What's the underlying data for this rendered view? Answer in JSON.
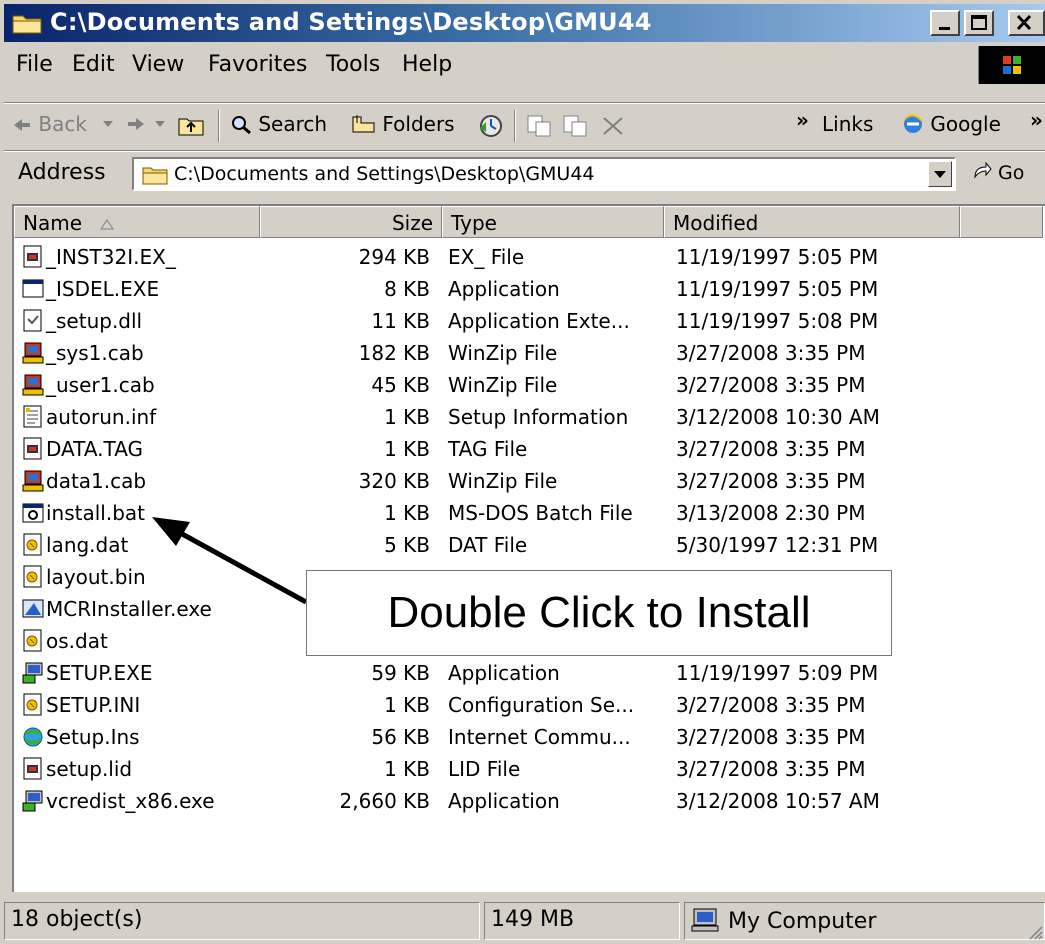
{
  "window": {
    "title": "C:\\Documents and Settings\\Desktop\\GMU44"
  },
  "menu": [
    {
      "label": "File"
    },
    {
      "label": "Edit"
    },
    {
      "label": "View"
    },
    {
      "label": "Favorites"
    },
    {
      "label": "Tools"
    },
    {
      "label": "Help"
    }
  ],
  "toolbar": {
    "back_label": "Back",
    "search_label": "Search",
    "folders_label": "Folders",
    "more_label": "»",
    "links_label": "Links",
    "google_label": "Google",
    "more2_label": "»"
  },
  "address": {
    "label": "Address",
    "value": "C:\\Documents and Settings\\Desktop\\GMU44",
    "go_label": "Go"
  },
  "columns": {
    "name": "Name",
    "size": "Size",
    "type": "Type",
    "modified": "Modified"
  },
  "files": [
    {
      "name": "_INST32I.EX_",
      "size": "294 KB",
      "type": "EX_ File",
      "modified": "11/19/1997 5:05 PM",
      "icon": "generic-file-icon"
    },
    {
      "name": "_ISDEL.EXE",
      "size": "8 KB",
      "type": "Application",
      "modified": "11/19/1997 5:05 PM",
      "icon": "exe-window-icon"
    },
    {
      "name": "_setup.dll",
      "size": "11 KB",
      "type": "Application Exte...",
      "modified": "11/19/1997 5:08 PM",
      "icon": "dll-icon"
    },
    {
      "name": "_sys1.cab",
      "size": "182 KB",
      "type": "WinZip File",
      "modified": "3/27/2008 3:35 PM",
      "icon": "winzip-icon"
    },
    {
      "name": "_user1.cab",
      "size": "45 KB",
      "type": "WinZip File",
      "modified": "3/27/2008 3:35 PM",
      "icon": "winzip-icon"
    },
    {
      "name": "autorun.inf",
      "size": "1 KB",
      "type": "Setup Information",
      "modified": "3/12/2008 10:30 AM",
      "icon": "inf-icon"
    },
    {
      "name": "DATA.TAG",
      "size": "1 KB",
      "type": "TAG File",
      "modified": "3/27/2008 3:35 PM",
      "icon": "generic-file-icon"
    },
    {
      "name": "data1.cab",
      "size": "320 KB",
      "type": "WinZip File",
      "modified": "3/27/2008 3:35 PM",
      "icon": "winzip-icon"
    },
    {
      "name": "install.bat",
      "size": "1 KB",
      "type": "MS-DOS Batch File",
      "modified": "3/13/2008 2:30 PM",
      "icon": "batch-file-icon"
    },
    {
      "name": "lang.dat",
      "size": "5 KB",
      "type": "DAT File",
      "modified": "5/30/1997 12:31 PM",
      "icon": "dat-file-icon"
    },
    {
      "name": "layout.bin",
      "size": "",
      "type": "",
      "modified": "",
      "icon": "dat-file-icon"
    },
    {
      "name": "MCRInstaller.exe",
      "size": "",
      "type": "",
      "modified": "",
      "icon": "installer-icon"
    },
    {
      "name": "os.dat",
      "size": "",
      "type": "",
      "modified": "",
      "icon": "dat-file-icon"
    },
    {
      "name": "SETUP.EXE",
      "size": "59 KB",
      "type": "Application",
      "modified": "11/19/1997 5:09 PM",
      "icon": "setup-exe-icon"
    },
    {
      "name": "SETUP.INI",
      "size": "1 KB",
      "type": "Configuration Se...",
      "modified": "3/27/2008 3:35 PM",
      "icon": "dat-file-icon"
    },
    {
      "name": "Setup.Ins",
      "size": "56 KB",
      "type": "Internet Commu...",
      "modified": "3/27/2008 3:35 PM",
      "icon": "internet-icon"
    },
    {
      "name": "setup.lid",
      "size": "1 KB",
      "type": "LID File",
      "modified": "3/27/2008 3:35 PM",
      "icon": "generic-file-icon"
    },
    {
      "name": "vcredist_x86.exe",
      "size": "2,660 KB",
      "type": "Application",
      "modified": "3/12/2008 10:57 AM",
      "icon": "setup-exe-icon"
    }
  ],
  "status": {
    "objects": "18 object(s)",
    "size": "149 MB",
    "zone": "My Computer"
  },
  "callout": {
    "text": "Double Click to Install"
  },
  "colors": {
    "titlebar_start": "#0a246a",
    "titlebar_end": "#a6caf0",
    "face": "#d4d0c8"
  }
}
